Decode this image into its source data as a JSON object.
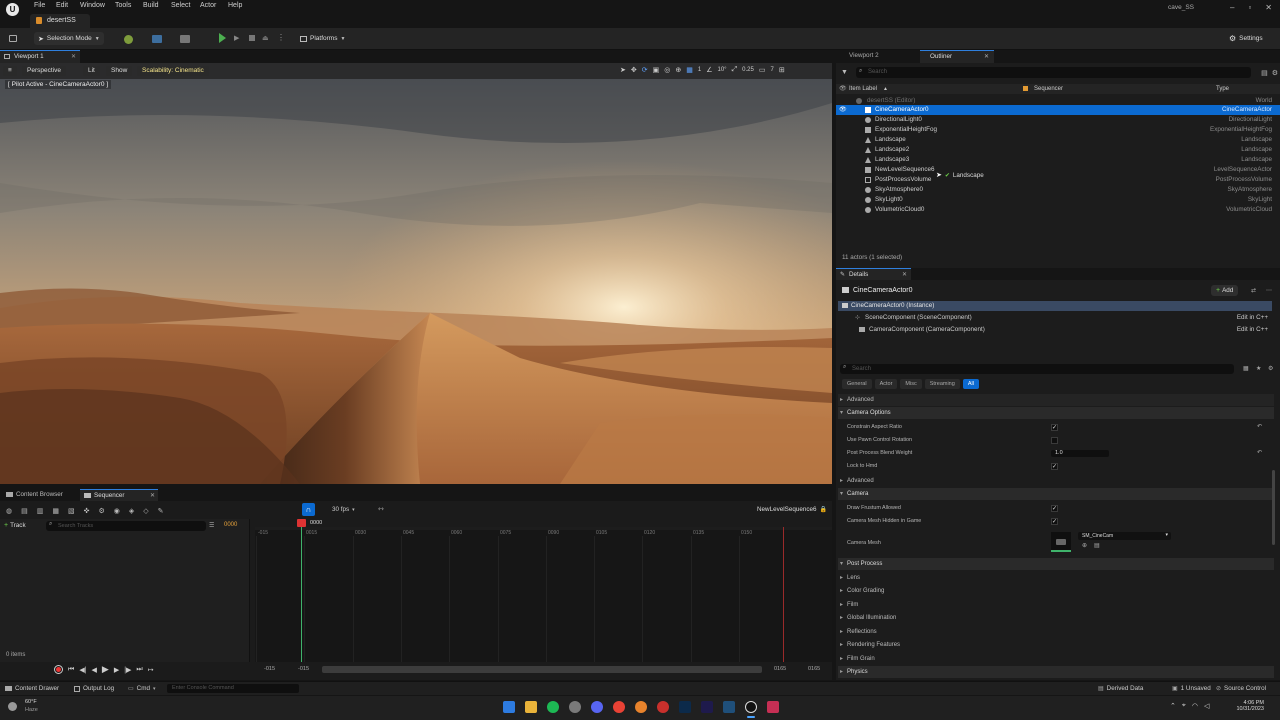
{
  "menu": [
    "File",
    "Edit",
    "Window",
    "Tools",
    "Build",
    "Select",
    "Actor",
    "Help"
  ],
  "project_tab": "desertSS",
  "project_name": "cave_SS",
  "toolbar": {
    "selection_mode": "Selection Mode",
    "platforms": "Platforms",
    "settings": "Settings"
  },
  "viewport": {
    "tab": "Viewport 1",
    "perspective": "Perspective",
    "lit": "Lit",
    "show": "Show",
    "scalability": "Scalability: Cinematic",
    "pilot_label": "[ Pilot Active - CineCameraActor0 ]",
    "grid_values": [
      "10°",
      "0.25",
      "7"
    ]
  },
  "outliner": {
    "tabs": [
      "Viewport 2",
      "Outliner"
    ],
    "search_placeholder": "Search",
    "col_label": "Item Label",
    "col_sequencer": "Sequencer",
    "col_type": "Type",
    "world": {
      "name": "desertSS (Editor)",
      "type": "World"
    },
    "items": [
      {
        "name": "CineCameraActor0",
        "type": "CineCameraActor",
        "selected": true
      },
      {
        "name": "DirectionalLight0",
        "type": "DirectionalLight"
      },
      {
        "name": "ExponentialHeightFog",
        "type": "ExponentialHeightFog"
      },
      {
        "name": "Landscape",
        "type": "Landscape"
      },
      {
        "name": "Landscape2",
        "type": "Landscape"
      },
      {
        "name": "Landscape3",
        "type": "Landscape"
      },
      {
        "name": "NewLevelSequence6",
        "type": "LevelSequenceActor"
      },
      {
        "name": "PostProcessVolume",
        "type": "PostProcessVolume"
      },
      {
        "name": "SkyAtmosphere0",
        "type": "SkyAtmosphere"
      },
      {
        "name": "SkyLight0",
        "type": "SkyLight"
      },
      {
        "name": "VolumetricCloud0",
        "type": "VolumetricCloud"
      }
    ],
    "tooltip": "Landscape",
    "count": "11 actors (1 selected)"
  },
  "details": {
    "tab": "Details",
    "actor_name": "CineCameraActor0",
    "add_label": "Add",
    "components": [
      {
        "name": "CineCameraActor0 (Instance)",
        "edit": ""
      },
      {
        "name": "SceneComponent (SceneComponent)",
        "edit": "Edit in C++"
      },
      {
        "name": "CameraComponent (CameraComponent)",
        "edit": "Edit in C++"
      }
    ],
    "search_placeholder": "Search",
    "filters": [
      "General",
      "Actor",
      "Misc",
      "Streaming",
      "All"
    ],
    "sections": {
      "advanced": "Advanced",
      "camera_options": "Camera Options",
      "constrain_aspect": "Constrain Aspect Ratio",
      "use_pawn": "Use Pawn Control Rotation",
      "blend_weight": "Post Process Blend Weight",
      "blend_value": "1.0",
      "lock_hmd": "Lock to Hmd",
      "advanced2": "Advanced",
      "camera": "Camera",
      "draw_frustum": "Draw Frustum Allowed",
      "mesh_hidden": "Camera Mesh Hidden in Game",
      "camera_mesh": "Camera Mesh",
      "mesh_value": "SM_CineCam",
      "post_process": "Post Process",
      "lens": "Lens",
      "color_grading": "Color Grading",
      "film": "Film",
      "gi": "Global Illumination",
      "reflections": "Reflections",
      "rendering": "Rendering Features",
      "film_grain": "Film Grain",
      "physics": "Physics"
    }
  },
  "bottom_tabs": [
    "Content Browser",
    "Sequencer"
  ],
  "sequencer": {
    "fps": "30 fps",
    "sequence_name": "NewLevelSequence6",
    "track_label": "Track",
    "search_placeholder": "Search Tracks",
    "current_frame": "0000",
    "ticks": [
      "-015",
      "0015",
      "0030",
      "0045",
      "0060",
      "0075",
      "0090",
      "0105",
      "0120",
      "0135",
      "0150"
    ],
    "range_start": "-015",
    "range_start2": "-015",
    "range_end": "0165",
    "range_end2": "0165",
    "items_count": "0 items"
  },
  "statusbar": {
    "content_drawer": "Content Drawer",
    "output_log": "Output Log",
    "cmd": "Cmd",
    "console_placeholder": "Enter Console Command",
    "derived_data": "Derived Data",
    "unsaved": "1 Unsaved",
    "source_control": "Source Control"
  },
  "taskbar": {
    "weather_temp": "60°F",
    "weather_desc": "Haze",
    "time": "4:06 PM",
    "date": "10/31/2023"
  }
}
